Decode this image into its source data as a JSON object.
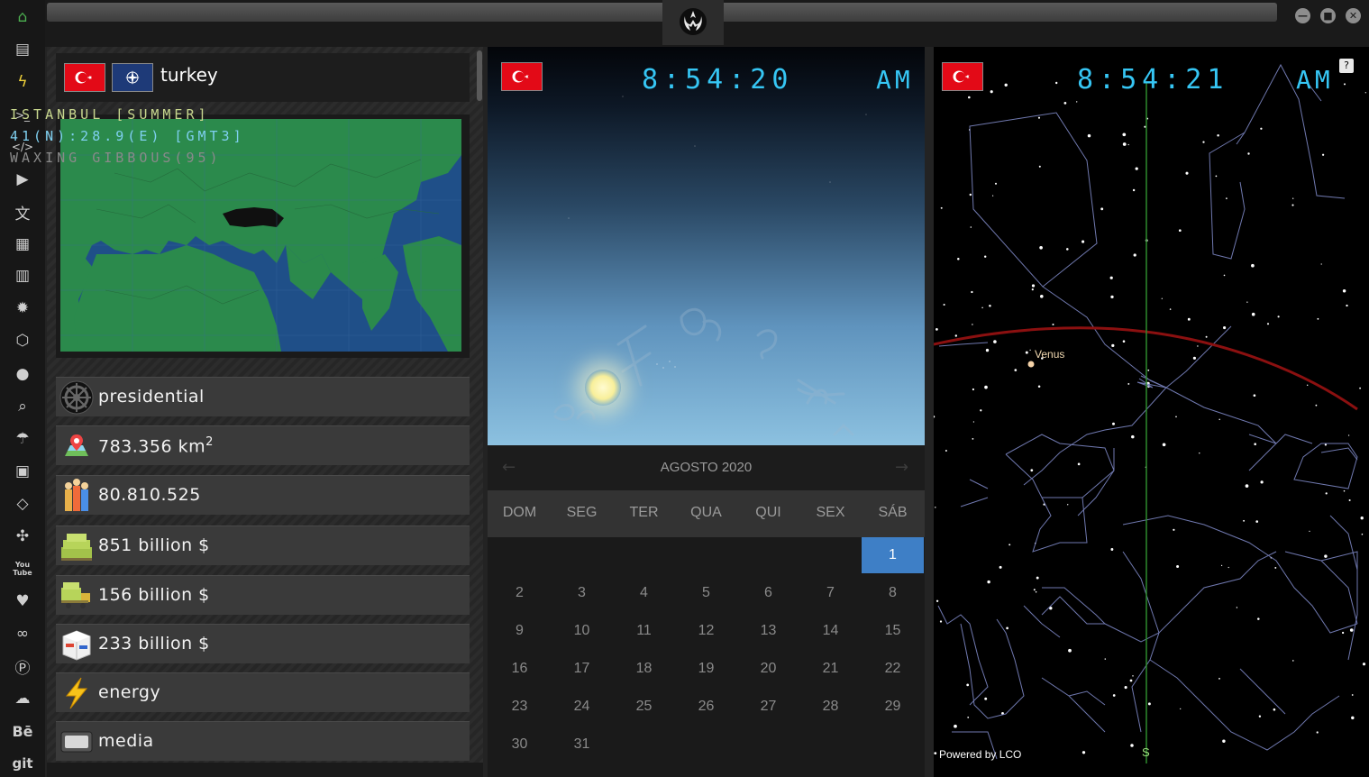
{
  "iconbar": {
    "items": [
      "home-icon",
      "document-icon",
      "bolt-icon",
      "terminal-icon",
      "code-icon",
      "play-icon",
      "translate-icon",
      "image-icon",
      "newspaper-icon",
      "aperture-icon",
      "polyhedron-icon",
      "globe-icon",
      "search-icon",
      "umbrella-icon",
      "contacts-icon",
      "link-icon",
      "expand-icon",
      "youtube-icon",
      "heart-icon",
      "infinity-icon",
      "pinterest-icon",
      "cloud-icon",
      "behance-icon",
      "git-icon"
    ],
    "youtube_text": "You\nTube",
    "behance_text": "Bē",
    "git_text": "git",
    "active_color": "#4caf50"
  },
  "window": {
    "buttons": [
      "minimize",
      "maximize",
      "close"
    ]
  },
  "country": {
    "name": "turkey",
    "government": "presidential",
    "area": "783.356 km",
    "area_sup": "2",
    "population": "80.810.525",
    "gdp": "851 billion $",
    "exports": "156 billion $",
    "imports": "233 billion $",
    "energy": "energy",
    "media": "media"
  },
  "clock1": {
    "time": "8:54:20",
    "ampm": "AM",
    "city_line": "ISTANBUL [SUMMER]",
    "coords_line": "41(N):28.9(E) [GMT3]",
    "moon_line": "WAXING GIBBOUS(95)"
  },
  "calendar": {
    "title": "AGOSTO 2020",
    "prev": "←",
    "next": "→",
    "weekdays": [
      "DOM",
      "SEG",
      "TER",
      "QUA",
      "QUI",
      "SEX",
      "SÁB"
    ],
    "first_weekday_index": 6,
    "days_in_month": 31,
    "selected_day": 1,
    "selected_color": "#3e7fc6"
  },
  "clock2": {
    "time": "8:54:21",
    "ampm": "AM",
    "help": "?",
    "venus_label": "Venus",
    "powered_by": "Powered by LCO",
    "south_label": "S"
  },
  "colors": {
    "clock": "#36c6f4",
    "city_line": "#c8d78e",
    "coords_line": "#7fd0f0",
    "moon_line": "#8a8a8a",
    "ecliptic": "#8b1010",
    "meridian": "#2e8b2e",
    "constellation": "#7c86c2"
  }
}
